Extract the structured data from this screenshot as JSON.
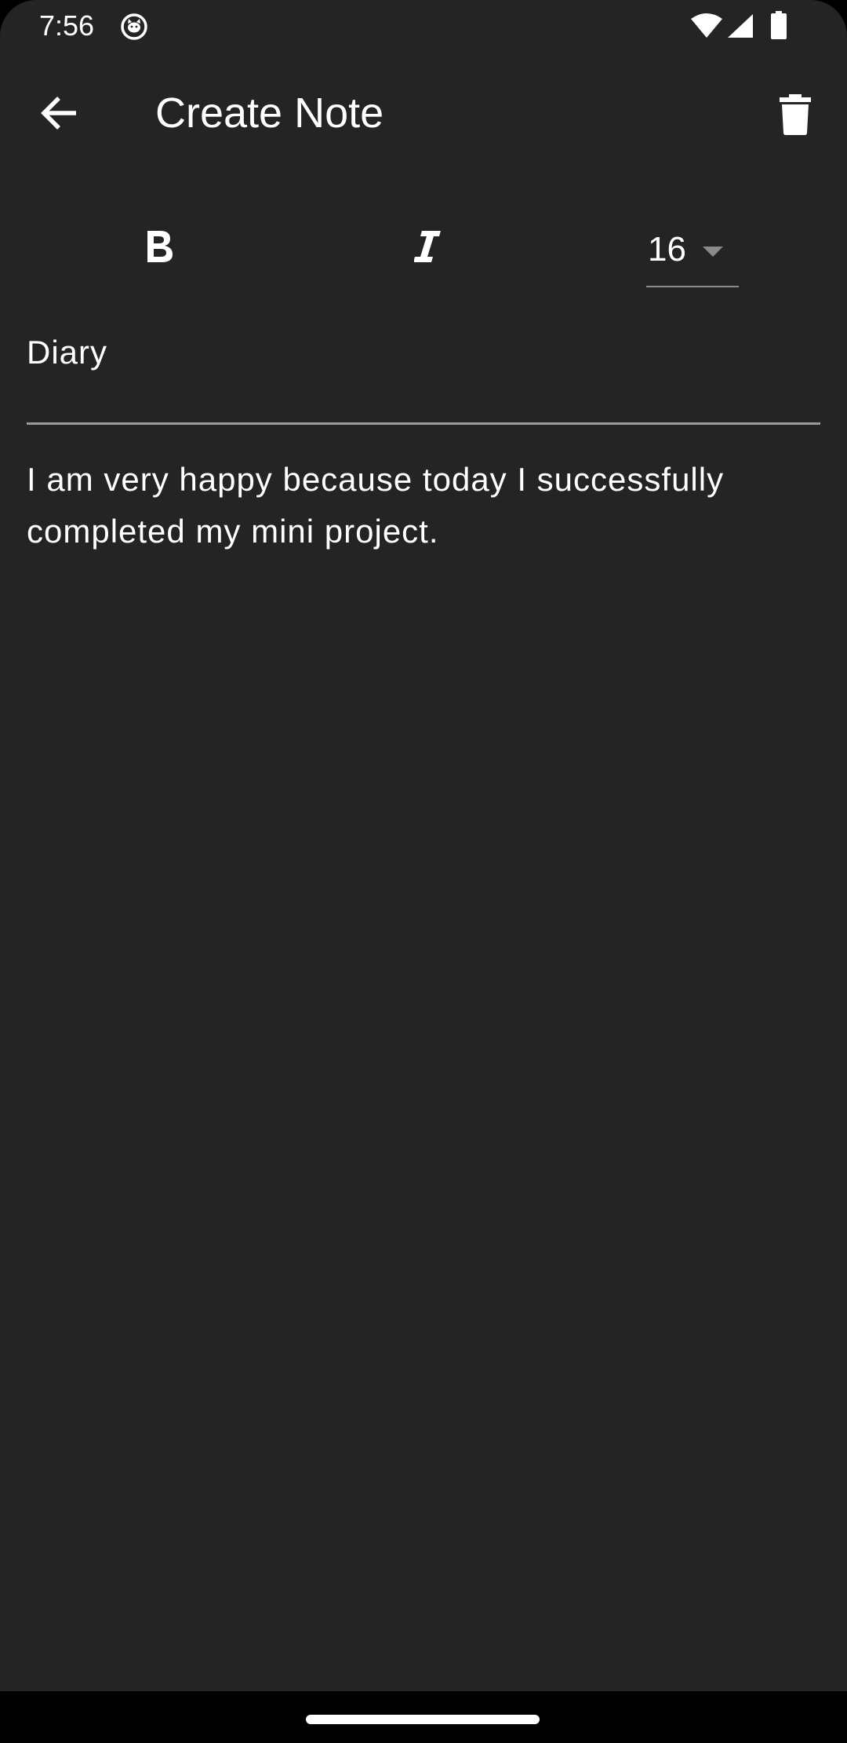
{
  "status_bar": {
    "time": "7:56",
    "icons": [
      "cat-app-icon",
      "wifi-icon",
      "signal-icon",
      "battery-icon"
    ]
  },
  "app_bar": {
    "title": "Create Note",
    "back_icon": "arrow-left-icon",
    "delete_icon": "trash-icon"
  },
  "toolbar": {
    "bold_label": "B",
    "italic_label": "I",
    "font_size": "16"
  },
  "note": {
    "title": "Diary",
    "body": "I am very happy because today I successfully completed my mini project."
  },
  "colors": {
    "background": "#242424",
    "text": "#ffffff",
    "divider": "#9a9a9a",
    "nav_bar": "#000000"
  }
}
